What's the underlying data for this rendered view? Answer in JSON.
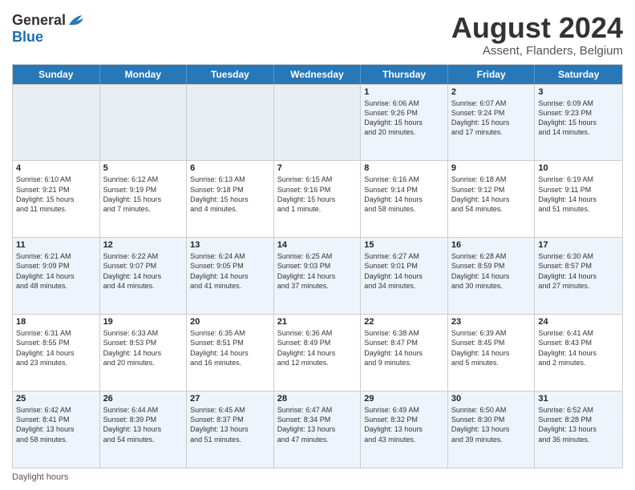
{
  "header": {
    "logo_general": "General",
    "logo_blue": "Blue",
    "main_title": "August 2024",
    "subtitle": "Assent, Flanders, Belgium"
  },
  "calendar": {
    "days_of_week": [
      "Sunday",
      "Monday",
      "Tuesday",
      "Wednesday",
      "Thursday",
      "Friday",
      "Saturday"
    ],
    "rows": [
      [
        {
          "day": "",
          "info": ""
        },
        {
          "day": "",
          "info": ""
        },
        {
          "day": "",
          "info": ""
        },
        {
          "day": "",
          "info": ""
        },
        {
          "day": "1",
          "info": "Sunrise: 6:06 AM\nSunset: 9:26 PM\nDaylight: 15 hours\nand 20 minutes."
        },
        {
          "day": "2",
          "info": "Sunrise: 6:07 AM\nSunset: 9:24 PM\nDaylight: 15 hours\nand 17 minutes."
        },
        {
          "day": "3",
          "info": "Sunrise: 6:09 AM\nSunset: 9:23 PM\nDaylight: 15 hours\nand 14 minutes."
        }
      ],
      [
        {
          "day": "4",
          "info": "Sunrise: 6:10 AM\nSunset: 9:21 PM\nDaylight: 15 hours\nand 11 minutes."
        },
        {
          "day": "5",
          "info": "Sunrise: 6:12 AM\nSunset: 9:19 PM\nDaylight: 15 hours\nand 7 minutes."
        },
        {
          "day": "6",
          "info": "Sunrise: 6:13 AM\nSunset: 9:18 PM\nDaylight: 15 hours\nand 4 minutes."
        },
        {
          "day": "7",
          "info": "Sunrise: 6:15 AM\nSunset: 9:16 PM\nDaylight: 15 hours\nand 1 minute."
        },
        {
          "day": "8",
          "info": "Sunrise: 6:16 AM\nSunset: 9:14 PM\nDaylight: 14 hours\nand 58 minutes."
        },
        {
          "day": "9",
          "info": "Sunrise: 6:18 AM\nSunset: 9:12 PM\nDaylight: 14 hours\nand 54 minutes."
        },
        {
          "day": "10",
          "info": "Sunrise: 6:19 AM\nSunset: 9:11 PM\nDaylight: 14 hours\nand 51 minutes."
        }
      ],
      [
        {
          "day": "11",
          "info": "Sunrise: 6:21 AM\nSunset: 9:09 PM\nDaylight: 14 hours\nand 48 minutes."
        },
        {
          "day": "12",
          "info": "Sunrise: 6:22 AM\nSunset: 9:07 PM\nDaylight: 14 hours\nand 44 minutes."
        },
        {
          "day": "13",
          "info": "Sunrise: 6:24 AM\nSunset: 9:05 PM\nDaylight: 14 hours\nand 41 minutes."
        },
        {
          "day": "14",
          "info": "Sunrise: 6:25 AM\nSunset: 9:03 PM\nDaylight: 14 hours\nand 37 minutes."
        },
        {
          "day": "15",
          "info": "Sunrise: 6:27 AM\nSunset: 9:01 PM\nDaylight: 14 hours\nand 34 minutes."
        },
        {
          "day": "16",
          "info": "Sunrise: 6:28 AM\nSunset: 8:59 PM\nDaylight: 14 hours\nand 30 minutes."
        },
        {
          "day": "17",
          "info": "Sunrise: 6:30 AM\nSunset: 8:57 PM\nDaylight: 14 hours\nand 27 minutes."
        }
      ],
      [
        {
          "day": "18",
          "info": "Sunrise: 6:31 AM\nSunset: 8:55 PM\nDaylight: 14 hours\nand 23 minutes."
        },
        {
          "day": "19",
          "info": "Sunrise: 6:33 AM\nSunset: 8:53 PM\nDaylight: 14 hours\nand 20 minutes."
        },
        {
          "day": "20",
          "info": "Sunrise: 6:35 AM\nSunset: 8:51 PM\nDaylight: 14 hours\nand 16 minutes."
        },
        {
          "day": "21",
          "info": "Sunrise: 6:36 AM\nSunset: 8:49 PM\nDaylight: 14 hours\nand 12 minutes."
        },
        {
          "day": "22",
          "info": "Sunrise: 6:38 AM\nSunset: 8:47 PM\nDaylight: 14 hours\nand 9 minutes."
        },
        {
          "day": "23",
          "info": "Sunrise: 6:39 AM\nSunset: 8:45 PM\nDaylight: 14 hours\nand 5 minutes."
        },
        {
          "day": "24",
          "info": "Sunrise: 6:41 AM\nSunset: 8:43 PM\nDaylight: 14 hours\nand 2 minutes."
        }
      ],
      [
        {
          "day": "25",
          "info": "Sunrise: 6:42 AM\nSunset: 8:41 PM\nDaylight: 13 hours\nand 58 minutes."
        },
        {
          "day": "26",
          "info": "Sunrise: 6:44 AM\nSunset: 8:39 PM\nDaylight: 13 hours\nand 54 minutes."
        },
        {
          "day": "27",
          "info": "Sunrise: 6:45 AM\nSunset: 8:37 PM\nDaylight: 13 hours\nand 51 minutes."
        },
        {
          "day": "28",
          "info": "Sunrise: 6:47 AM\nSunset: 8:34 PM\nDaylight: 13 hours\nand 47 minutes."
        },
        {
          "day": "29",
          "info": "Sunrise: 6:49 AM\nSunset: 8:32 PM\nDaylight: 13 hours\nand 43 minutes."
        },
        {
          "day": "30",
          "info": "Sunrise: 6:50 AM\nSunset: 8:30 PM\nDaylight: 13 hours\nand 39 minutes."
        },
        {
          "day": "31",
          "info": "Sunrise: 6:52 AM\nSunset: 8:28 PM\nDaylight: 13 hours\nand 36 minutes."
        }
      ]
    ]
  },
  "footer": {
    "note": "Daylight hours"
  }
}
